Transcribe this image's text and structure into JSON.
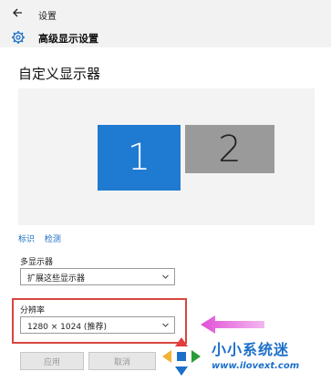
{
  "window": {
    "title": "设置"
  },
  "header": {
    "title": "高级显示设置"
  },
  "section": {
    "title": "自定义显示器"
  },
  "monitors": [
    {
      "label": "1",
      "state": "selected",
      "color": "#1f7ad1"
    },
    {
      "label": "2",
      "state": "inactive",
      "color": "#9a9a9a"
    }
  ],
  "links": {
    "identify": "标识",
    "detect": "检测"
  },
  "multi_display": {
    "label": "多显示器",
    "value": "扩展这些显示器"
  },
  "resolution": {
    "label": "分辨率",
    "value": "1280 × 1024 (推荐)"
  },
  "buttons": {
    "apply": "应用",
    "cancel": "取消"
  },
  "watermark": {
    "name": "小小系统迷",
    "url": "www.ilovext.com"
  },
  "colors": {
    "accent": "#1f7ad1",
    "highlight": "#d9453f",
    "arrow": "#e24fd8"
  },
  "icons": {
    "back": "back-arrow-icon",
    "settings": "gear-icon",
    "dropdown": "chevron-down-icon",
    "annotation": "arrow-left-icon"
  }
}
